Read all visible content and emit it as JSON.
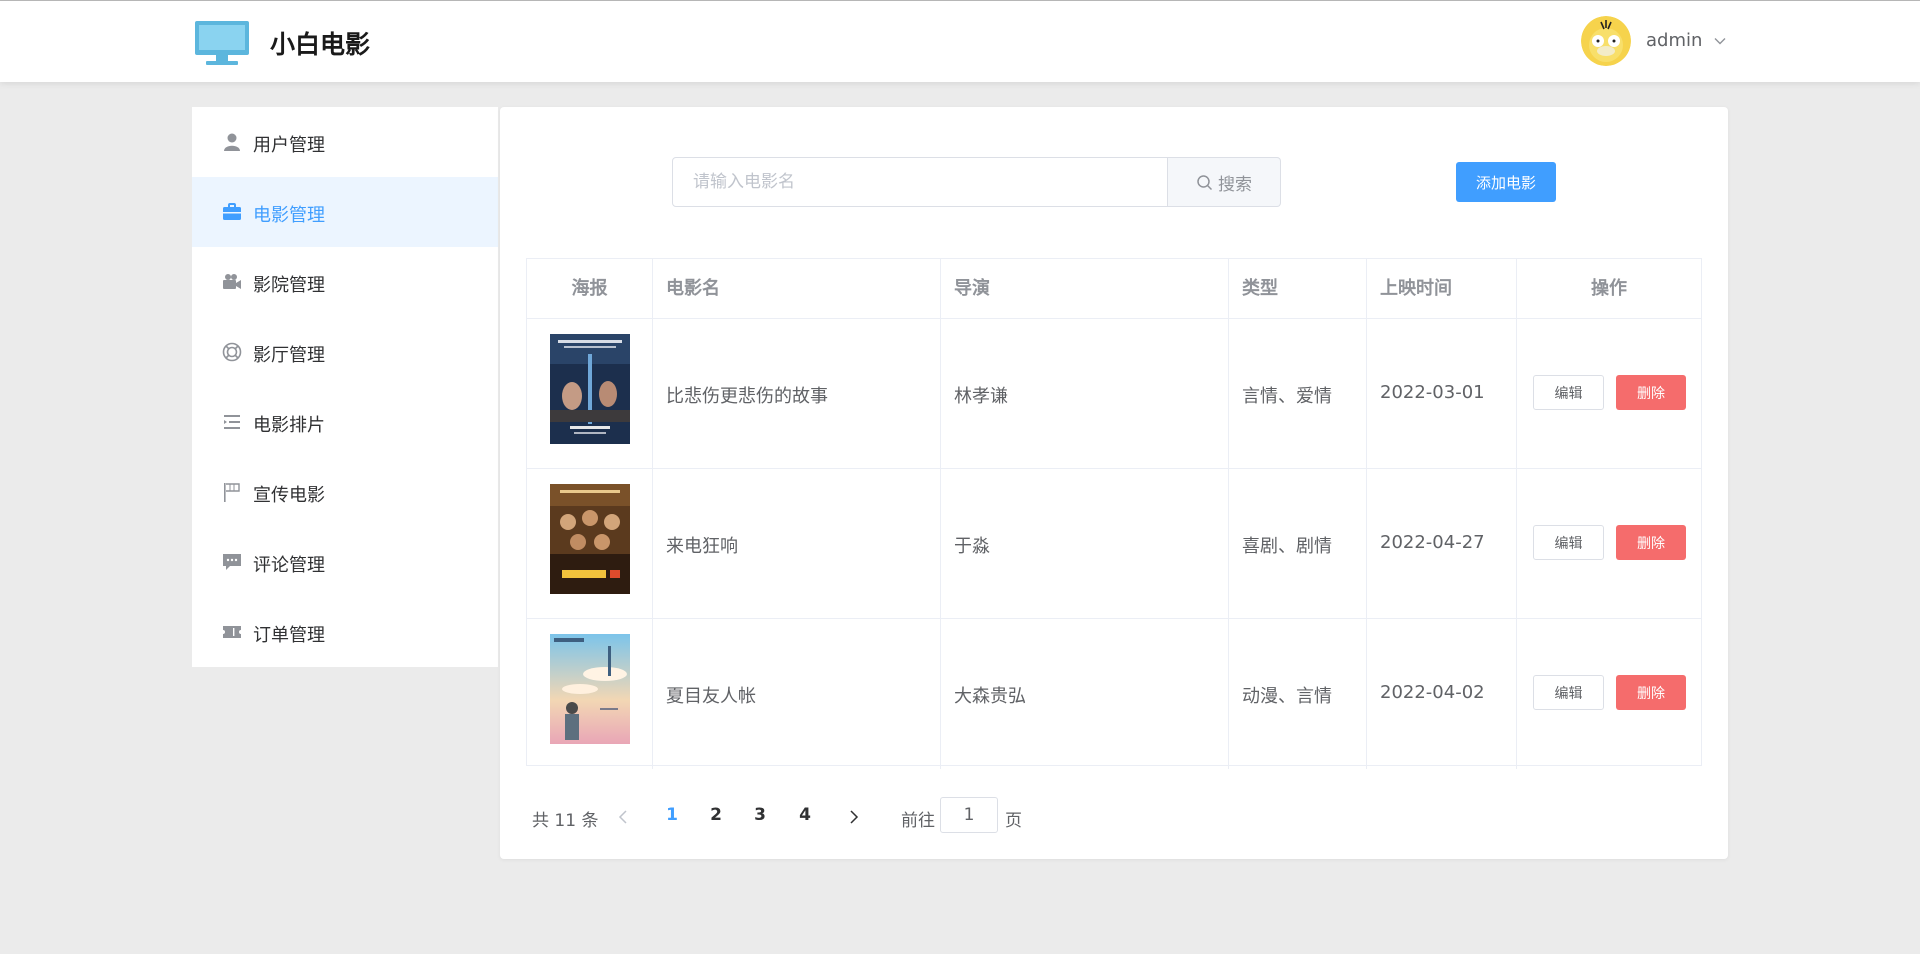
{
  "header": {
    "brand": "小白电影",
    "username": "admin"
  },
  "sidebar": {
    "items": [
      {
        "label": "用户管理",
        "icon": "user-icon"
      },
      {
        "label": "电影管理",
        "icon": "briefcase-icon",
        "active": true
      },
      {
        "label": "影院管理",
        "icon": "camera-icon"
      },
      {
        "label": "影厅管理",
        "icon": "lifebuoy-icon"
      },
      {
        "label": "电影排片",
        "icon": "list-indent-icon"
      },
      {
        "label": "宣传电影",
        "icon": "flag-icon"
      },
      {
        "label": "评论管理",
        "icon": "chat-icon"
      },
      {
        "label": "订单管理",
        "icon": "ticket-icon"
      }
    ]
  },
  "search": {
    "placeholder": "请输入电影名",
    "button_label": "搜索"
  },
  "add_button_label": "添加电影",
  "table": {
    "columns": [
      "海报",
      "电影名",
      "导演",
      "类型",
      "上映时间",
      "操作"
    ],
    "rows": [
      {
        "name": "比悲伤更悲伤的故事",
        "director": "林孝谦",
        "genre": "言情、爱情",
        "date": "2022-03-01",
        "edit": "编辑",
        "delete": "删除"
      },
      {
        "name": "来电狂响",
        "director": "于淼",
        "genre": "喜剧、剧情",
        "date": "2022-04-27",
        "edit": "编辑",
        "delete": "删除"
      },
      {
        "name": "夏目友人帐",
        "director": "大森贵弘",
        "genre": "动漫、言情",
        "date": "2022-04-02",
        "edit": "编辑",
        "delete": "删除"
      }
    ]
  },
  "pagination": {
    "total": "共 11 条",
    "pages": [
      "1",
      "2",
      "3",
      "4"
    ],
    "current": "1",
    "goto_label": "前往",
    "goto_value": "1",
    "page_unit": "页"
  },
  "colors": {
    "primary": "#409eff",
    "danger": "#f56c6c",
    "active_bg": "#ecf5ff"
  }
}
